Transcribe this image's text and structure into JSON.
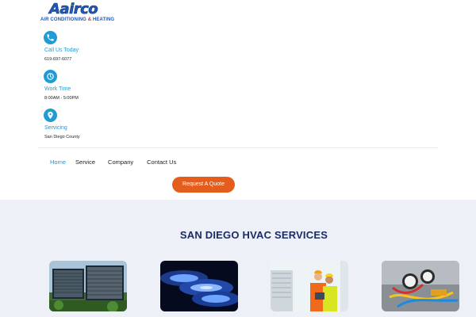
{
  "logo": {
    "wordmark": "Aairco",
    "tagline_a": "AIR CONDITIONING",
    "tagline_amp": "&",
    "tagline_b": "HEATING"
  },
  "contacts": [
    {
      "label": "Call Us Today",
      "value": "619-697-6077",
      "icon": "phone-icon"
    },
    {
      "label": "Work Time",
      "value": "8:00AM - 5:00PM",
      "icon": "clock-icon"
    },
    {
      "label": "Servicing",
      "value": "San Diego County",
      "icon": "location-pin-icon"
    }
  ],
  "nav": {
    "items": [
      "Home",
      "Service",
      "Company",
      "Contact Us"
    ],
    "active": "Home"
  },
  "cta": {
    "label": "Request A Quote"
  },
  "services": {
    "title": "SAN DIEGO HVAC SERVICES"
  },
  "colors": {
    "accent": "#1f9bd6",
    "cta": "#e45d1c",
    "heading": "#1b2b63",
    "section_bg": "#edf1f7"
  }
}
